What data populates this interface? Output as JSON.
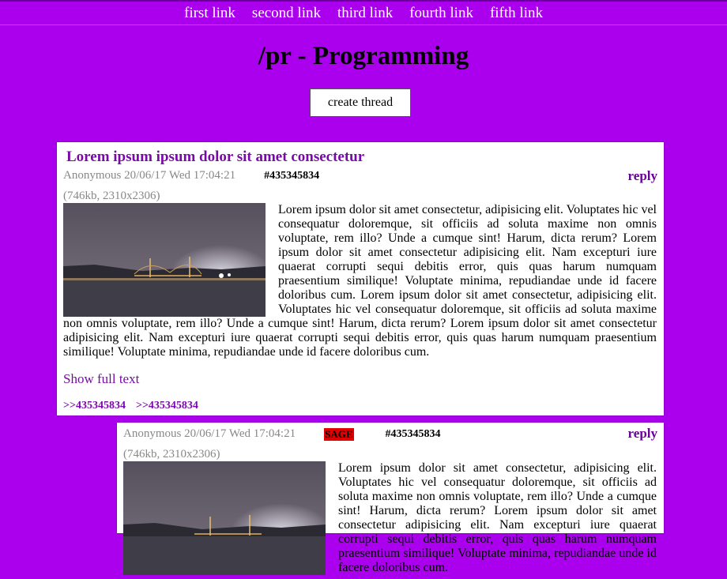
{
  "nav": {
    "links": [
      "first link",
      "second link",
      "third link",
      "fourth link",
      "fifth link"
    ]
  },
  "board": {
    "title": "/pr - Programming",
    "create_label": "create thread"
  },
  "op": {
    "title": "Lorem ipsum ipsum dolor sit amet consectetur",
    "author_date": "Anonymous 20/06/17 Wed 17:04:21",
    "post_number": "#435345834",
    "reply_label": "reply",
    "file_info": "(746kb, 2310x2306)",
    "body": "Lorem ipsum dolor sit amet consectetur, adipisicing elit. Voluptates hic vel consequatur doloremque, sit officiis ad soluta maxime non omnis voluptate, rem illo? Unde a cumque sint! Harum, dicta rerum? Lorem ipsum dolor sit amet consectetur adipisicing elit. Nam excepturi iure quaerat corrupti sequi debitis error, quis quas harum numquam praesentium similique! Voluptate minima, repudiandae unde id facere doloribus cum. Lorem ipsum dolor sit amet consectetur, adipisicing elit. Voluptates hic vel consequatur doloremque, sit officiis ad soluta maxime non omnis voluptate, rem illo? Unde a cumque sint! Harum, dicta rerum? Lorem ipsum dolor sit amet consectetur adipisicing elit. Nam excepturi iure quaerat corrupti sequi debitis error, quis quas harum numquam praesentium similique! Voluptate minima, repudiandae unde id facere doloribus cum.",
    "show_full_label": "Show full text",
    "backlinks": [
      ">>435345834",
      ">>435345834"
    ]
  },
  "reply": {
    "author_date": "Anonymous 20/06/17 Wed 17:04:21",
    "sage_label": "SAGE",
    "post_number": "#435345834",
    "reply_label": "reply",
    "file_info": "(746kb, 2310x2306)",
    "body": "Lorem ipsum dolor sit amet consectetur, adipisicing elit. Voluptates hic vel consequatur doloremque, sit officiis ad soluta maxime non omnis voluptate, rem illo? Unde a cumque sint! Harum, dicta rerum? Lorem ipsum dolor sit amet consectetur adipisicing elit. Nam excepturi iure quaerat corrupti sequi debitis error, quis quas harum numquam praesentium similique! Voluptate minima, repudiandae unde id facere doloribus cum."
  },
  "colors": {
    "background": "#aa00ee",
    "link": "#7a0aa8",
    "sage": "#e00000"
  }
}
